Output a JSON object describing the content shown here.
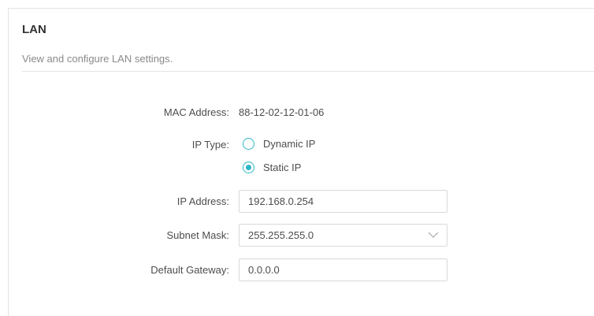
{
  "section": {
    "title": "LAN",
    "description": "View and configure LAN settings."
  },
  "form": {
    "mac_label": "MAC Address:",
    "mac_value": "88-12-02-12-01-06",
    "ip_type_label": "IP Type:",
    "ip_type_options": [
      {
        "label": "Dynamic IP",
        "selected": false
      },
      {
        "label": "Static IP",
        "selected": true
      }
    ],
    "ip_address_label": "IP Address:",
    "ip_address_value": "192.168.0.254",
    "subnet_label": "Subnet Mask:",
    "subnet_value": "255.255.255.0",
    "gateway_label": "Default Gateway:",
    "gateway_value": "0.0.0.0"
  },
  "colors": {
    "accent": "#2eb6c8",
    "text": "#4d4d4d",
    "muted": "#8a8a8a",
    "border": "#d9d9d9"
  },
  "icons": {
    "subnet_dropdown": "chevron-down-icon"
  }
}
